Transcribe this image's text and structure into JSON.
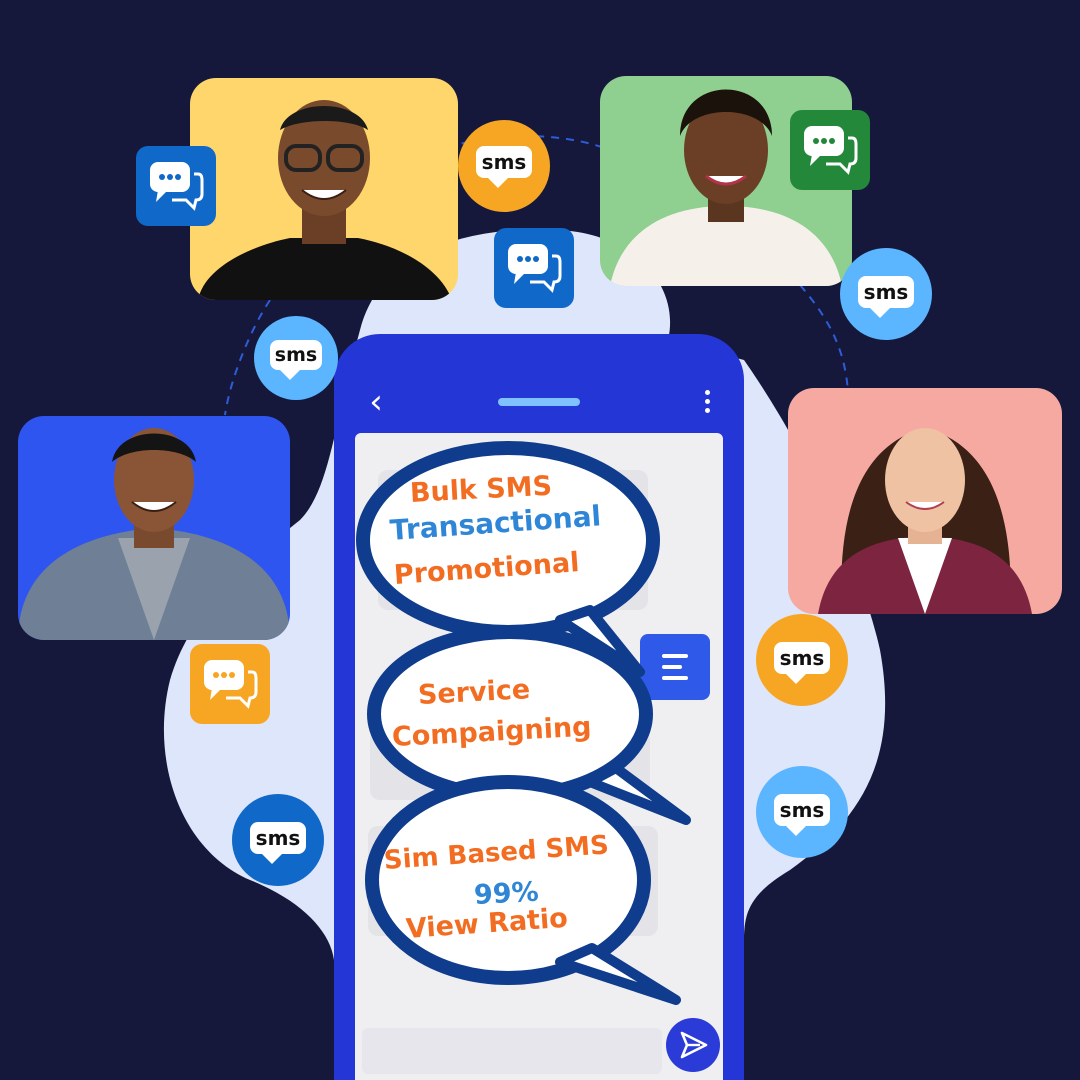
{
  "colors": {
    "background": "#15183a",
    "phone_body": "#2536d6",
    "bubble_outline": "#0f3c8c",
    "text_orange": "#f26d21",
    "text_blue": "#2f86d6",
    "badge_orange": "#f6a623",
    "badge_light_blue": "#5bb5ff",
    "badge_dark_blue": "#1068c8"
  },
  "sms_badge_label": "sms",
  "bubbles": [
    {
      "lines": [
        "Bulk SMS",
        "Transactional",
        "Promotional"
      ]
    },
    {
      "lines": [
        "Service",
        "Compaigning"
      ]
    },
    {
      "lines": [
        "Sim Based SMS",
        "99%",
        "View Ratio"
      ]
    }
  ],
  "icons": {
    "back": "chevron-left-icon",
    "menu": "more-vertical-icon",
    "send": "send-icon",
    "chat": "chat-bubbles-icon"
  },
  "people": [
    {
      "background": "#ffd66b"
    },
    {
      "background": "#8fcf8f"
    },
    {
      "background": "#2f55f0"
    },
    {
      "background": "#f6a9a1"
    }
  ]
}
